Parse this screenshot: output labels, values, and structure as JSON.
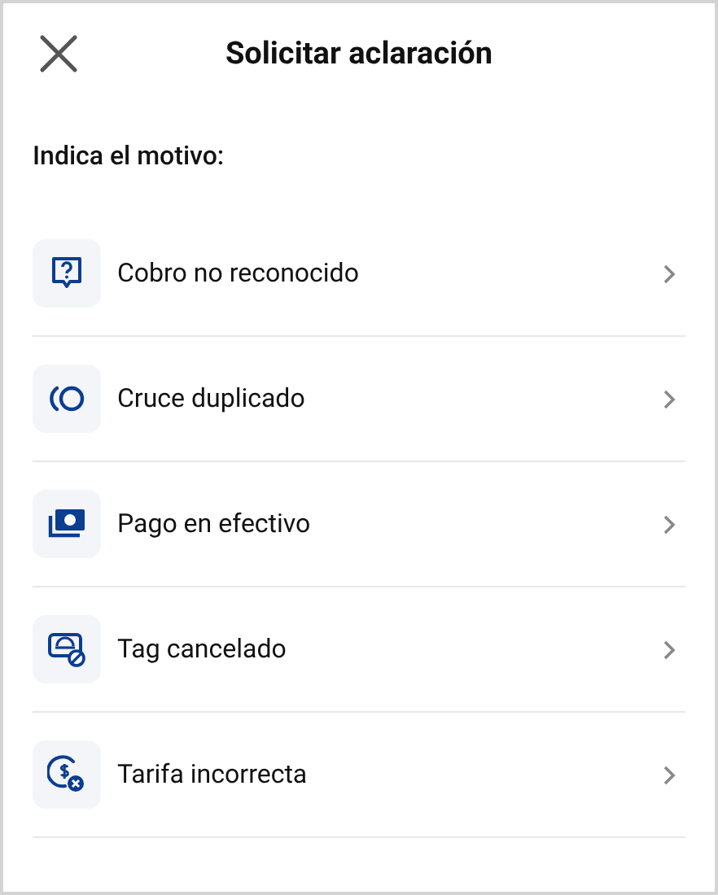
{
  "header": {
    "title": "Solicitar aclaración"
  },
  "prompt": "Indica el motivo:",
  "reasons": [
    {
      "kind": "question",
      "label": "Cobro no reconocido"
    },
    {
      "kind": "duplicate",
      "label": "Cruce duplicado"
    },
    {
      "kind": "cash",
      "label": "Pago en efectivo"
    },
    {
      "kind": "tag",
      "label": "Tag cancelado"
    },
    {
      "kind": "fare",
      "label": "Tarifa incorrecta"
    }
  ]
}
